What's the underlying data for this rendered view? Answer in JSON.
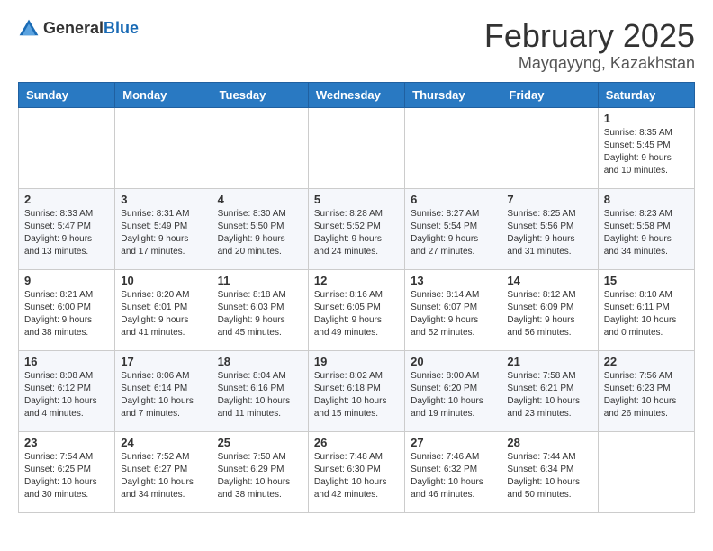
{
  "logo": {
    "general": "General",
    "blue": "Blue"
  },
  "header": {
    "month": "February 2025",
    "location": "Mayqayyng, Kazakhstan"
  },
  "weekdays": [
    "Sunday",
    "Monday",
    "Tuesday",
    "Wednesday",
    "Thursday",
    "Friday",
    "Saturday"
  ],
  "weeks": [
    [
      {
        "day": "",
        "info": ""
      },
      {
        "day": "",
        "info": ""
      },
      {
        "day": "",
        "info": ""
      },
      {
        "day": "",
        "info": ""
      },
      {
        "day": "",
        "info": ""
      },
      {
        "day": "",
        "info": ""
      },
      {
        "day": "1",
        "info": "Sunrise: 8:35 AM\nSunset: 5:45 PM\nDaylight: 9 hours and 10 minutes."
      }
    ],
    [
      {
        "day": "2",
        "info": "Sunrise: 8:33 AM\nSunset: 5:47 PM\nDaylight: 9 hours and 13 minutes."
      },
      {
        "day": "3",
        "info": "Sunrise: 8:31 AM\nSunset: 5:49 PM\nDaylight: 9 hours and 17 minutes."
      },
      {
        "day": "4",
        "info": "Sunrise: 8:30 AM\nSunset: 5:50 PM\nDaylight: 9 hours and 20 minutes."
      },
      {
        "day": "5",
        "info": "Sunrise: 8:28 AM\nSunset: 5:52 PM\nDaylight: 9 hours and 24 minutes."
      },
      {
        "day": "6",
        "info": "Sunrise: 8:27 AM\nSunset: 5:54 PM\nDaylight: 9 hours and 27 minutes."
      },
      {
        "day": "7",
        "info": "Sunrise: 8:25 AM\nSunset: 5:56 PM\nDaylight: 9 hours and 31 minutes."
      },
      {
        "day": "8",
        "info": "Sunrise: 8:23 AM\nSunset: 5:58 PM\nDaylight: 9 hours and 34 minutes."
      }
    ],
    [
      {
        "day": "9",
        "info": "Sunrise: 8:21 AM\nSunset: 6:00 PM\nDaylight: 9 hours and 38 minutes."
      },
      {
        "day": "10",
        "info": "Sunrise: 8:20 AM\nSunset: 6:01 PM\nDaylight: 9 hours and 41 minutes."
      },
      {
        "day": "11",
        "info": "Sunrise: 8:18 AM\nSunset: 6:03 PM\nDaylight: 9 hours and 45 minutes."
      },
      {
        "day": "12",
        "info": "Sunrise: 8:16 AM\nSunset: 6:05 PM\nDaylight: 9 hours and 49 minutes."
      },
      {
        "day": "13",
        "info": "Sunrise: 8:14 AM\nSunset: 6:07 PM\nDaylight: 9 hours and 52 minutes."
      },
      {
        "day": "14",
        "info": "Sunrise: 8:12 AM\nSunset: 6:09 PM\nDaylight: 9 hours and 56 minutes."
      },
      {
        "day": "15",
        "info": "Sunrise: 8:10 AM\nSunset: 6:11 PM\nDaylight: 10 hours and 0 minutes."
      }
    ],
    [
      {
        "day": "16",
        "info": "Sunrise: 8:08 AM\nSunset: 6:12 PM\nDaylight: 10 hours and 4 minutes."
      },
      {
        "day": "17",
        "info": "Sunrise: 8:06 AM\nSunset: 6:14 PM\nDaylight: 10 hours and 7 minutes."
      },
      {
        "day": "18",
        "info": "Sunrise: 8:04 AM\nSunset: 6:16 PM\nDaylight: 10 hours and 11 minutes."
      },
      {
        "day": "19",
        "info": "Sunrise: 8:02 AM\nSunset: 6:18 PM\nDaylight: 10 hours and 15 minutes."
      },
      {
        "day": "20",
        "info": "Sunrise: 8:00 AM\nSunset: 6:20 PM\nDaylight: 10 hours and 19 minutes."
      },
      {
        "day": "21",
        "info": "Sunrise: 7:58 AM\nSunset: 6:21 PM\nDaylight: 10 hours and 23 minutes."
      },
      {
        "day": "22",
        "info": "Sunrise: 7:56 AM\nSunset: 6:23 PM\nDaylight: 10 hours and 26 minutes."
      }
    ],
    [
      {
        "day": "23",
        "info": "Sunrise: 7:54 AM\nSunset: 6:25 PM\nDaylight: 10 hours and 30 minutes."
      },
      {
        "day": "24",
        "info": "Sunrise: 7:52 AM\nSunset: 6:27 PM\nDaylight: 10 hours and 34 minutes."
      },
      {
        "day": "25",
        "info": "Sunrise: 7:50 AM\nSunset: 6:29 PM\nDaylight: 10 hours and 38 minutes."
      },
      {
        "day": "26",
        "info": "Sunrise: 7:48 AM\nSunset: 6:30 PM\nDaylight: 10 hours and 42 minutes."
      },
      {
        "day": "27",
        "info": "Sunrise: 7:46 AM\nSunset: 6:32 PM\nDaylight: 10 hours and 46 minutes."
      },
      {
        "day": "28",
        "info": "Sunrise: 7:44 AM\nSunset: 6:34 PM\nDaylight: 10 hours and 50 minutes."
      },
      {
        "day": "",
        "info": ""
      }
    ]
  ]
}
